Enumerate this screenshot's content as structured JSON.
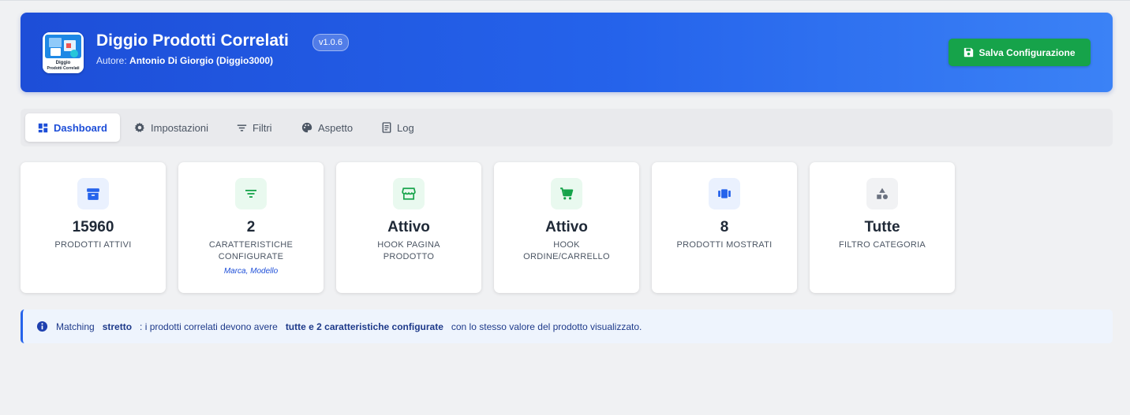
{
  "header": {
    "title": "Diggio Prodotti Correlati",
    "version": "v1.0.6",
    "author_label": "Autore:",
    "author_name": "Antonio Di Giorgio (Diggio3000)",
    "logo_text_1": "Diggio",
    "logo_text_2": "Prodotti Correlati",
    "save_label": "Salva Configurazione"
  },
  "tabs": [
    {
      "label": "Dashboard",
      "icon": "dashboard-icon",
      "active": true
    },
    {
      "label": "Impostazioni",
      "icon": "gear-icon",
      "active": false
    },
    {
      "label": "Filtri",
      "icon": "filter-icon",
      "active": false
    },
    {
      "label": "Aspetto",
      "icon": "palette-icon",
      "active": false
    },
    {
      "label": "Log",
      "icon": "document-icon",
      "active": false
    }
  ],
  "stats": [
    {
      "value": "15960",
      "label": "PRODOTTI ATTIVI",
      "icon": "archive-icon",
      "color": "#2563eb"
    },
    {
      "value": "2",
      "label": "CARATTERISTICHE CONFIGURATE",
      "sub": "Marca, Modello",
      "icon": "filter-icon",
      "color": "#16a34a"
    },
    {
      "value": "Attivo",
      "label": "HOOK PAGINA PRODOTTO",
      "icon": "store-icon",
      "color": "#16a34a"
    },
    {
      "value": "Attivo",
      "label": "HOOK ORDINE/CARRELLO",
      "icon": "cart-icon",
      "color": "#16a34a"
    },
    {
      "value": "8",
      "label": "PRODOTTI MOSTRATI",
      "icon": "carousel-icon",
      "color": "#2563eb"
    },
    {
      "value": "Tutte",
      "label": "FILTRO CATEGORIA",
      "icon": "shapes-icon",
      "color": "#6b7280"
    }
  ],
  "info": {
    "part1": "Matching",
    "bold1": "stretto",
    "part2": ": i prodotti correlati devono avere",
    "bold2": "tutte e 2 caratteristiche configurate",
    "part3": "con lo stesso valore del prodotto visualizzato."
  },
  "colors": {
    "header_start": "#1d4ed8",
    "header_end": "#3b82f6",
    "save": "#16a34a",
    "accent": "#1d4ed8"
  }
}
